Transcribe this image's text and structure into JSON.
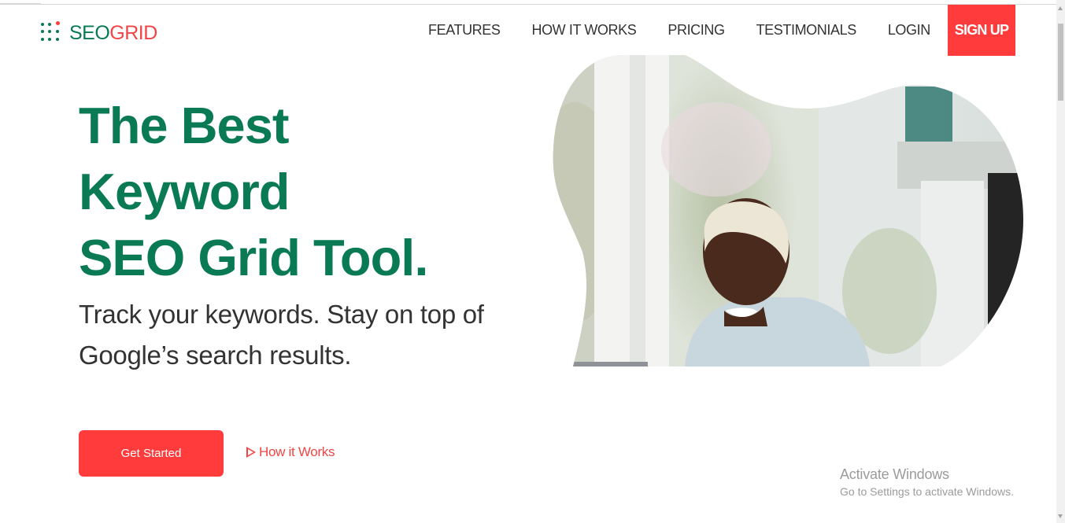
{
  "logo": {
    "part1": "SEO",
    "part2": "GRID",
    "icon": "dot-grid-icon",
    "colors": {
      "green": "#0a7a55",
      "red": "#f24545"
    }
  },
  "nav": {
    "items": [
      {
        "label": "FEATURES"
      },
      {
        "label": "HOW IT WORKS"
      },
      {
        "label": "PRICING"
      },
      {
        "label": "TESTIMONIALS"
      },
      {
        "label": "LOGIN"
      }
    ],
    "signup_label": "SIGN UP"
  },
  "hero": {
    "title_lines": [
      "The Best",
      "Keyword",
      "SEO Grid Tool."
    ],
    "subtitle": "Track your keywords. Stay on top of Google’s search results.",
    "cta_primary": "Get Started",
    "cta_secondary": "How it Works",
    "cta_secondary_icon": "play-outline-icon"
  },
  "watermark": {
    "title": "Activate Windows",
    "subtitle": "Go to Settings to activate Windows."
  },
  "colors": {
    "accent_red": "#ff3b3b",
    "brand_green": "#0a7a55",
    "text_dark": "#333333"
  }
}
